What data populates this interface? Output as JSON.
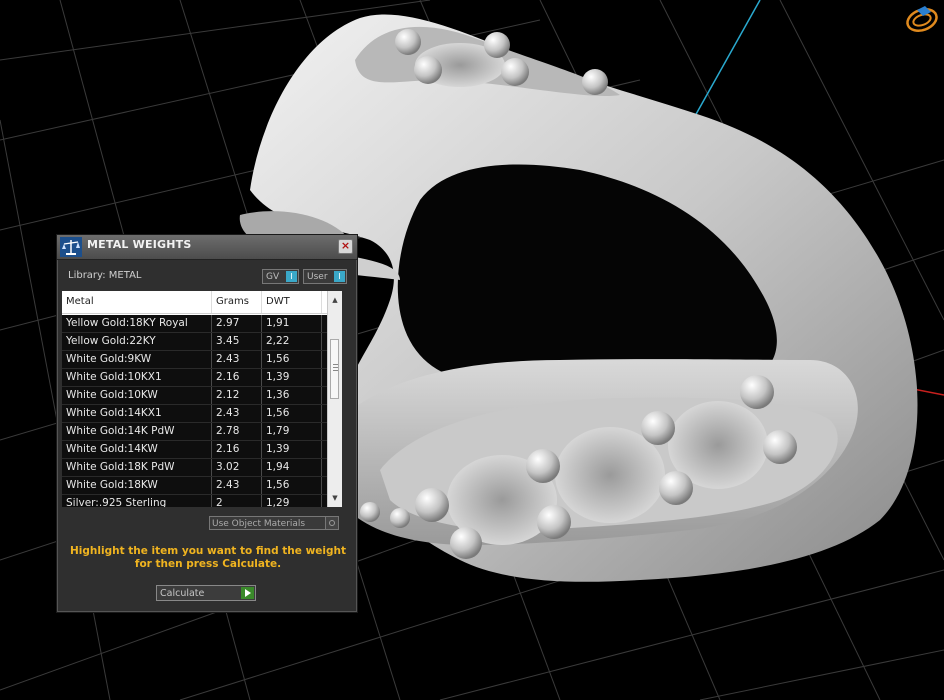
{
  "panel": {
    "title": "METAL WEIGHTS",
    "close_label": "×",
    "library_label": "Library: METAL",
    "toggles": [
      {
        "label": "GV",
        "indicator": "I"
      },
      {
        "label": "User",
        "indicator": "I"
      }
    ],
    "table": {
      "headers": [
        "Metal",
        "Grams",
        "DWT"
      ],
      "rows": [
        [
          "Yellow Gold:18KY Royal",
          "2.97",
          "1,91"
        ],
        [
          "Yellow Gold:22KY",
          "3.45",
          "2,22"
        ],
        [
          "White Gold:9KW",
          "2.43",
          "1,56"
        ],
        [
          "White Gold:10KX1",
          "2.16",
          "1,39"
        ],
        [
          "White Gold:10KW",
          "2.12",
          "1,36"
        ],
        [
          "White Gold:14KX1",
          "2.43",
          "1,56"
        ],
        [
          "White Gold:14K PdW",
          "2.78",
          "1,79"
        ],
        [
          "White Gold:14KW",
          "2.16",
          "1,39"
        ],
        [
          "White Gold:18K PdW",
          "3.02",
          "1,94"
        ],
        [
          "White Gold:18KW",
          "2.43",
          "1,56"
        ],
        [
          "Silver:.925 Sterling",
          "2",
          "1,29"
        ]
      ]
    },
    "use_object_materials": "Use Object Materials",
    "instructions": "Highlight the item you want to find the weight for then press Calculate.",
    "calculate_label": "Calculate"
  },
  "colors": {
    "instruction_text": "#f0b420",
    "toggle_indicator": "#3aa8c8",
    "calculate_arrow": "#3a8a2a"
  }
}
